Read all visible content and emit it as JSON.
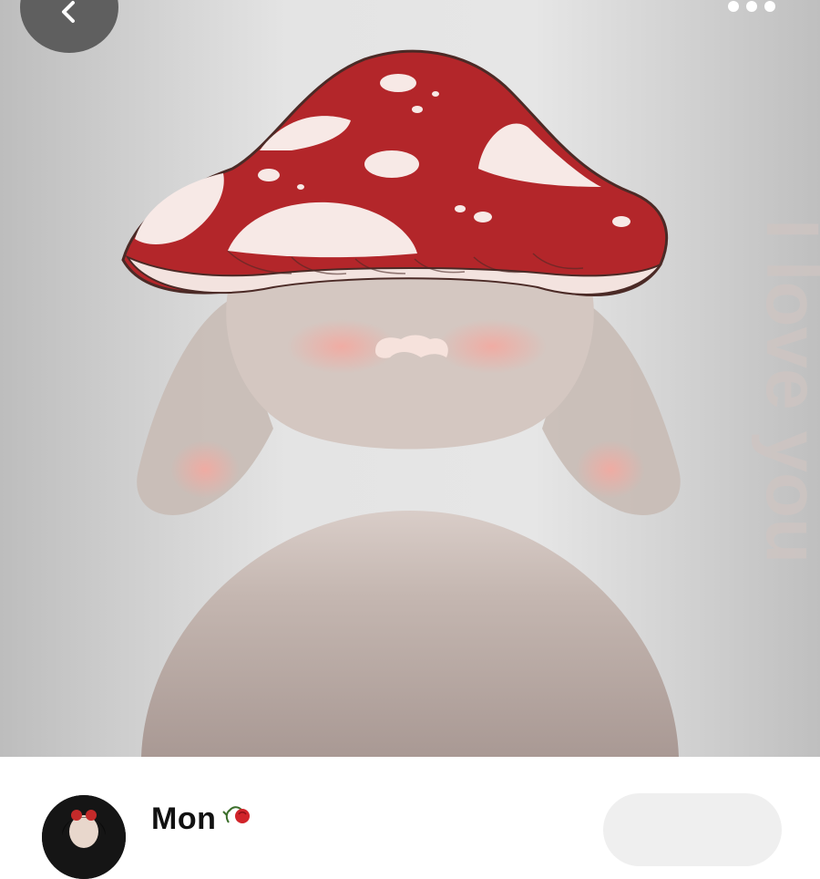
{
  "pin": {
    "overlay_text": "I love you",
    "colors": {
      "cap_red": "#b3262a",
      "spots": "#f7e9e6",
      "figure": "#b8a8a0",
      "blush": "#f0b1a4"
    }
  },
  "top_bar": {
    "back_icon": "chevron-left-icon",
    "more_icon": "more-horizontal-icon"
  },
  "creator": {
    "name": "Mon",
    "name_emoji_icon": "rose-icon"
  },
  "follow_button": {
    "label": ""
  }
}
